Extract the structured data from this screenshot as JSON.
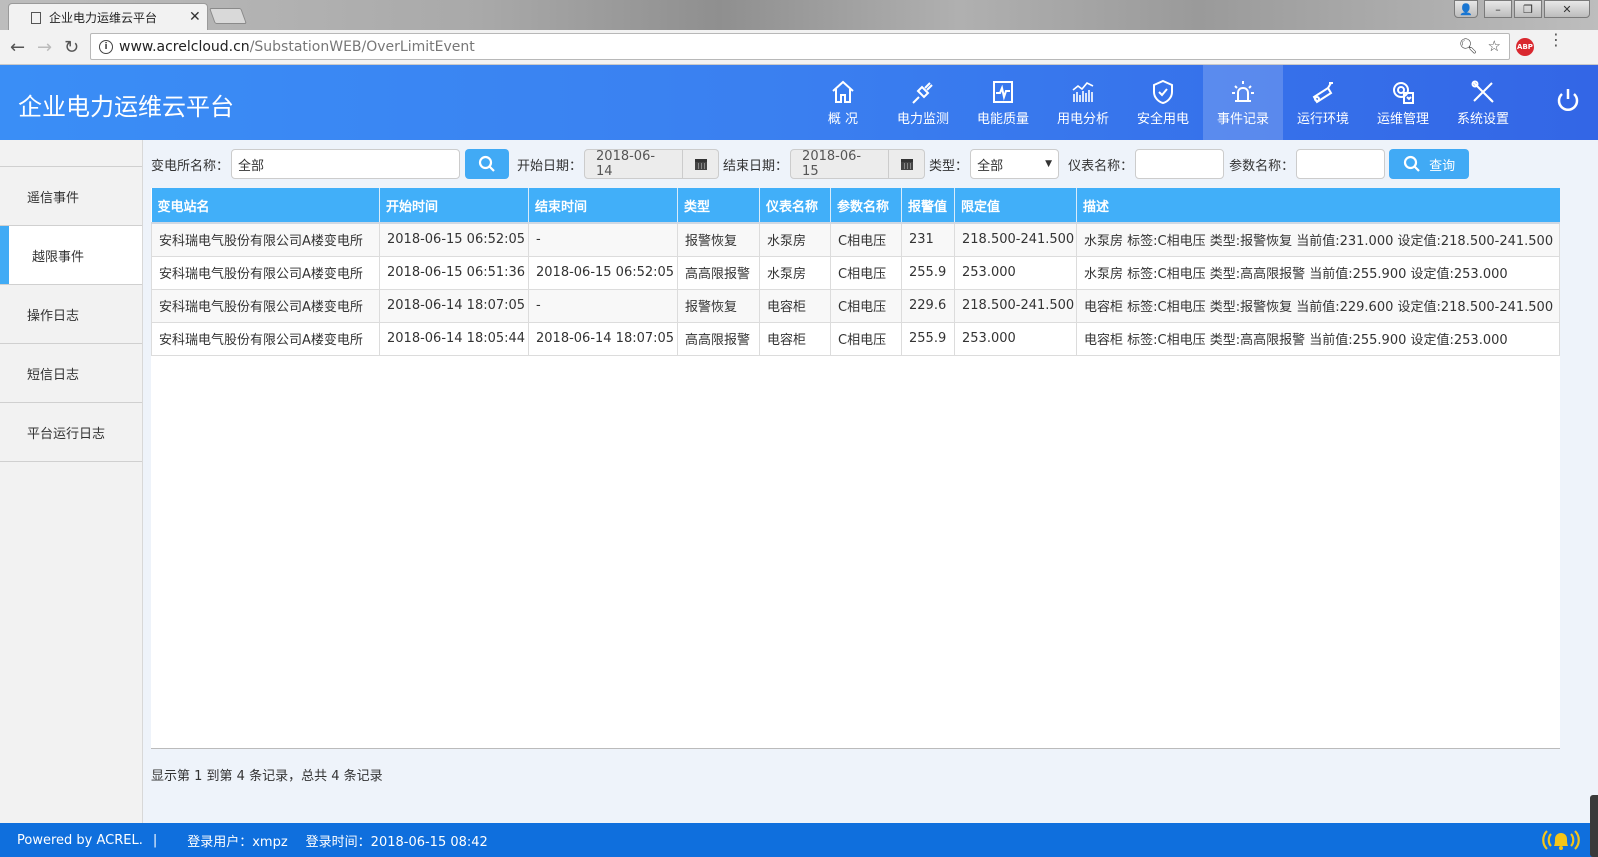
{
  "browser": {
    "tab_title": "企业电力运维云平台",
    "url_host": "www.acrelcloud.cn",
    "url_path": "/SubstationWEB/OverLimitEvent",
    "abp_label": "ABP"
  },
  "header": {
    "title": "企业电力运维云平台",
    "nav": [
      {
        "label": "概 况",
        "icon": "home-icon"
      },
      {
        "label": "电力监测",
        "icon": "plug-icon"
      },
      {
        "label": "电能质量",
        "icon": "waveform-monitor-icon"
      },
      {
        "label": "用电分析",
        "icon": "bar-chart-icon"
      },
      {
        "label": "安全用电",
        "icon": "shield-check-icon"
      },
      {
        "label": "事件记录",
        "icon": "alarm-light-icon",
        "active": true
      },
      {
        "label": "运行环境",
        "icon": "camera-icon"
      },
      {
        "label": "运维管理",
        "icon": "gear-doc-icon"
      },
      {
        "label": "系统设置",
        "icon": "tools-icon"
      }
    ]
  },
  "sidebar": {
    "items": [
      {
        "label": "遥信事件"
      },
      {
        "label": "越限事件",
        "active": true
      },
      {
        "label": "操作日志"
      },
      {
        "label": "短信日志"
      },
      {
        "label": "平台运行日志"
      }
    ]
  },
  "filters": {
    "station_label": "变电所名称：",
    "station_value": "全部",
    "start_label": "开始日期：",
    "start_value": "2018-06-14",
    "end_label": "结束日期：",
    "end_value": "2018-06-15",
    "type_label": "类型：",
    "type_value": "全部",
    "meter_label": "仪表名称：",
    "meter_value": "",
    "param_label": "参数名称：",
    "param_value": "",
    "query_label": "查询"
  },
  "table": {
    "columns": [
      "变电站名",
      "开始时间",
      "结束时间",
      "类型",
      "仪表名称",
      "参数名称",
      "报警值",
      "限定值",
      "描述"
    ],
    "rows": [
      [
        "安科瑞电气股份有限公司A楼变电所",
        "2018-06-15 06:52:05",
        "-",
        "报警恢复",
        "水泵房",
        "C相电压",
        "231",
        "218.500-241.500",
        "水泵房 标签:C相电压 类型:报警恢复 当前值:231.000 设定值:218.500-241.500"
      ],
      [
        "安科瑞电气股份有限公司A楼变电所",
        "2018-06-15 06:51:36",
        "2018-06-15 06:52:05",
        "高高限报警",
        "水泵房",
        "C相电压",
        "255.9",
        "253.000",
        "水泵房 标签:C相电压 类型:高高限报警 当前值:255.900 设定值:253.000"
      ],
      [
        "安科瑞电气股份有限公司A楼变电所",
        "2018-06-14 18:07:05",
        "-",
        "报警恢复",
        "电容柜",
        "C相电压",
        "229.6",
        "218.500-241.500",
        "电容柜 标签:C相电压 类型:报警恢复 当前值:229.600 设定值:218.500-241.500"
      ],
      [
        "安科瑞电气股份有限公司A楼变电所",
        "2018-06-14 18:05:44",
        "2018-06-14 18:07:05",
        "高高限报警",
        "电容柜",
        "C相电压",
        "255.9",
        "253.000",
        "电容柜 标签:C相电压 类型:高高限报警 当前值:255.900 设定值:253.000"
      ]
    ]
  },
  "pagination": {
    "info": "显示第 1 到第 4 条记录，总共 4 条记录"
  },
  "footer": {
    "powered": "Powered by ACREL.",
    "divider": "|",
    "user_label": "登录用户：xmpz",
    "time_label": "登录时间：2018-06-15 08:42"
  },
  "colors": {
    "header_blue": "#3a8ef6",
    "table_header": "#41aff9",
    "footer_blue": "#0f6fdd",
    "accent": "#41abf5",
    "bell_yellow": "#f5c518"
  }
}
